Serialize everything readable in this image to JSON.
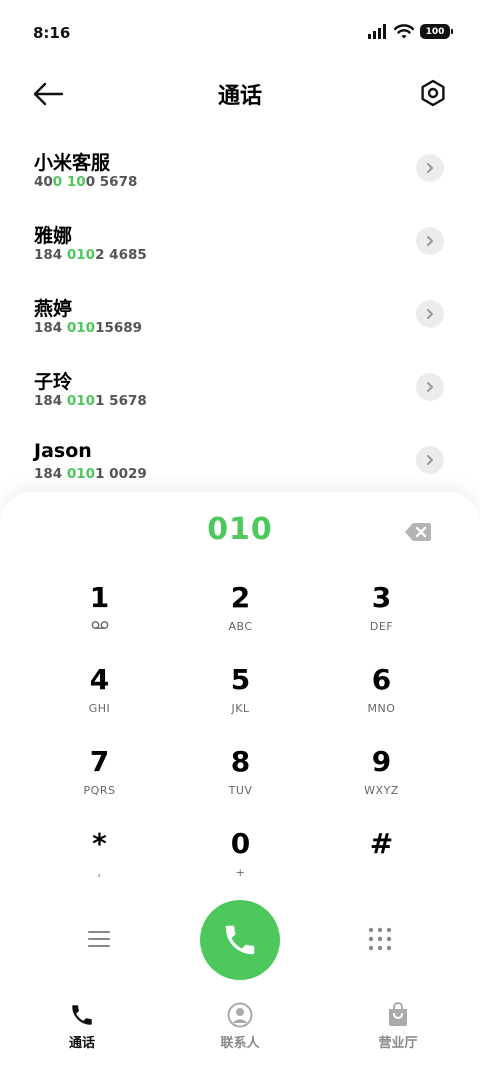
{
  "status_bar": {
    "time": "8:16",
    "battery": "100"
  },
  "header": {
    "title": "通话"
  },
  "contacts": [
    {
      "name": "小米客服",
      "number_pre": "40",
      "number_match": "0 10",
      "number_post": "0 5678"
    },
    {
      "name": "雅娜",
      "number_pre": "184 ",
      "number_match": "010",
      "number_post": "2 4685"
    },
    {
      "name": "燕婷",
      "number_pre": "184 ",
      "number_match": "010",
      "number_post": "15689"
    },
    {
      "name": "子玲",
      "number_pre": "184 ",
      "number_match": "010",
      "number_post": "1 5678"
    },
    {
      "name": "Jason",
      "number_pre": "184 ",
      "number_match": "010",
      "number_post": "1 0029"
    }
  ],
  "dialpad": {
    "entered": "010",
    "keys": [
      {
        "digit": "1",
        "sub": ""
      },
      {
        "digit": "2",
        "sub": "ABC"
      },
      {
        "digit": "3",
        "sub": "DEF"
      },
      {
        "digit": "4",
        "sub": "GHI"
      },
      {
        "digit": "5",
        "sub": "JKL"
      },
      {
        "digit": "6",
        "sub": "MNO"
      },
      {
        "digit": "7",
        "sub": "PQRS"
      },
      {
        "digit": "8",
        "sub": "TUV"
      },
      {
        "digit": "9",
        "sub": "WXYZ"
      },
      {
        "digit": "*",
        "sub": ","
      },
      {
        "digit": "0",
        "sub": "+"
      },
      {
        "digit": "#",
        "sub": ""
      }
    ]
  },
  "bottom_nav": {
    "calls": "通话",
    "contacts": "联系人",
    "store": "营业厅"
  },
  "colors": {
    "accent": "#4CC85C",
    "secondary_text": "#555555"
  },
  "icons": {
    "key_1_sub": "voicemail-icon",
    "back": "arrow-left-icon",
    "settings": "hexagon-settings-icon"
  }
}
